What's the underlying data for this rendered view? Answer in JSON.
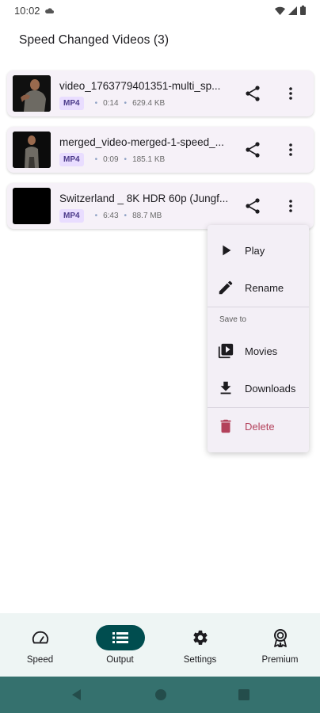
{
  "status_bar": {
    "time": "10:02"
  },
  "page": {
    "title": "Speed Changed Videos (3)"
  },
  "videos": [
    {
      "title": "video_1763779401351-multi_sp...",
      "format": "MP4",
      "duration": "0:14",
      "size": "629.4 KB"
    },
    {
      "title": "merged_video-merged-1-speed_...",
      "format": "MP4",
      "duration": "0:09",
      "size": "185.1 KB"
    },
    {
      "title": "Switzerland _ 8K HDR 60p (Jungf...",
      "format": "MP4",
      "duration": "6:43",
      "size": "88.7 MB"
    }
  ],
  "menu": {
    "play": "Play",
    "rename": "Rename",
    "save_to": "Save to",
    "movies": "Movies",
    "downloads": "Downloads",
    "delete": "Delete"
  },
  "bottom_nav": {
    "items": [
      {
        "label": "Speed",
        "icon": "speedometer-icon"
      },
      {
        "label": "Output",
        "icon": "list-icon",
        "active": true
      },
      {
        "label": "Settings",
        "icon": "gear-icon"
      },
      {
        "label": "Premium",
        "icon": "award-icon"
      }
    ]
  },
  "colors": {
    "card_bg": "#f6f1f8",
    "badge_bg": "#e9ddff",
    "active_nav": "#004d4f",
    "android_nav": "#35716e",
    "delete": "#b3415b"
  }
}
